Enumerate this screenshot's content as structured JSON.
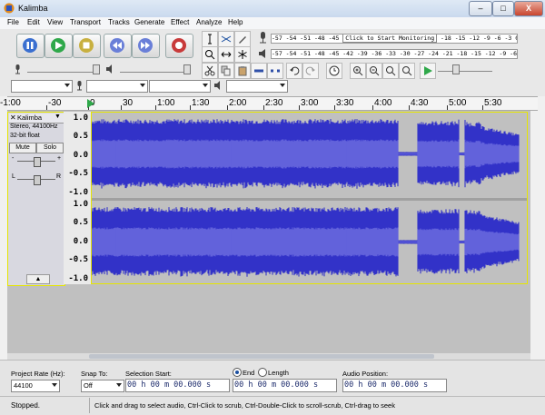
{
  "window": {
    "title": "Kalimba",
    "minimize": "–",
    "maximize": "□",
    "close": "X"
  },
  "menu": [
    "File",
    "Edit",
    "View",
    "Transport",
    "Tracks",
    "Generate",
    "Effect",
    "Analyze",
    "Help"
  ],
  "meters": {
    "record_scale": "-57 -54 -51 -48 -45",
    "record_prompt": "Click to Start Monitoring",
    "record_scale_tail": "-18 -15 -12 -9 -6 -3 0",
    "play_scale": "-57 -54 -51 -48 -45 -42 -39 -36 -33 -30 -27 -24 -21 -18 -15 -12 -9 -6 -3 0"
  },
  "ruler": {
    "labels": [
      "-1:00",
      "-30",
      "0",
      "30",
      "1:00",
      "1:30",
      "2:00",
      "2:30",
      "3:00",
      "3:30",
      "4:00",
      "4:30",
      "5:00",
      "5:30"
    ]
  },
  "track": {
    "name": "Kalimba",
    "info1": "Stereo, 44100Hz",
    "info2": "32-bit float",
    "mute": "Mute",
    "solo": "Solo",
    "gain_minus": "-",
    "gain_plus": "+",
    "pan_left": "L",
    "pan_right": "R",
    "scale": [
      "1.0",
      "0.5",
      "0.0",
      "-0.5",
      "-1.0"
    ],
    "channel_peaks": [
      0.95,
      0.95
    ]
  },
  "selection": {
    "project_rate_label": "Project Rate (Hz):",
    "project_rate": "44100",
    "snap_label": "Snap To:",
    "snap_value": "Off",
    "start_label": "Selection Start:",
    "start_value": "00 h 00 m 00.000 s",
    "end_label": "End",
    "length_label": "Length",
    "end_value": "00 h 00 m 00.000 s",
    "position_label": "Audio Position:",
    "position_value": "00 h 00 m 00.000 s"
  },
  "status": {
    "left": "Stopped.",
    "hint": "Click and drag to select audio, Ctrl-Click to scrub, Ctrl-Double-Click to scroll-scrub, Ctrl-drag to seek"
  },
  "colors": {
    "wave": "#3232c8",
    "wave_rms": "#6464dc",
    "selection_border": "#e6e600",
    "wave_bg": "#c0c0c0"
  }
}
